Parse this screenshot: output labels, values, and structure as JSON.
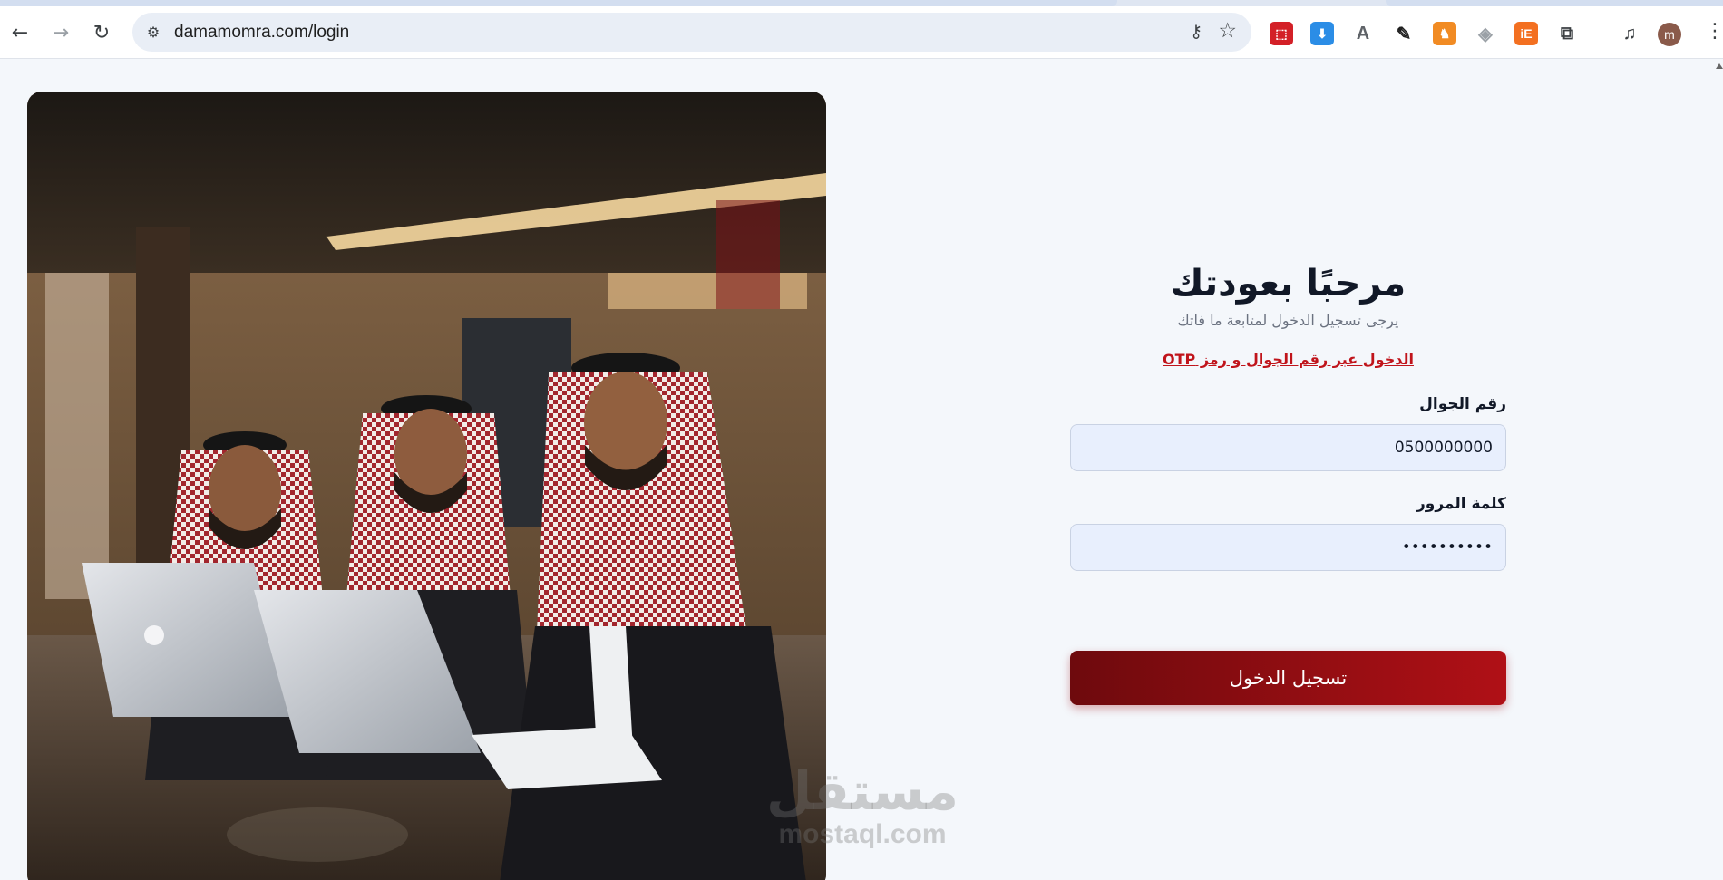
{
  "browser": {
    "url": "damamomra.com/login",
    "back_icon": "←",
    "forward_icon": "→",
    "reload_icon": "↻",
    "site_info_icon": "⚙",
    "key_icon": "⚷",
    "star_icon": "☆",
    "profile_initial": "m",
    "menu_icon": "⋮",
    "extensions": [
      {
        "name": "pdf-extension-icon",
        "glyph": "⬚",
        "color": "#d32027"
      },
      {
        "name": "download-extension-icon",
        "glyph": "⬇",
        "color": "#2b8de6"
      },
      {
        "name": "document-extension-icon",
        "glyph": "A",
        "color": "#5f6368"
      },
      {
        "name": "color-picker-extension-icon",
        "glyph": "✎",
        "color": "#1f1f1f"
      },
      {
        "name": "puzzle-character-extension-icon",
        "glyph": "♞",
        "color": "#f18b23"
      },
      {
        "name": "shield-extension-icon",
        "glyph": "◈",
        "color": "#9aa0a6"
      },
      {
        "name": "ie-extension-icon",
        "glyph": "iE",
        "color": "#f37021"
      },
      {
        "name": "extensions-puzzle-icon",
        "glyph": "⧉",
        "color": "#3c4043"
      },
      {
        "name": "media-controls-icon",
        "glyph": "♫",
        "color": "#3c4043"
      }
    ]
  },
  "login": {
    "title": "مرحبًا بعودتك",
    "subtitle": "يرجى تسجيل الدخول لمتابعة ما فاتك",
    "otp_link": "الدخول عبر رقم الجوال و رمز OTP",
    "phone_label": "رقم الجوال",
    "phone_value": "0500000000",
    "password_label": "كلمة المرور",
    "password_value": "••••••••••",
    "submit_label": "تسجيل الدخول"
  },
  "watermark": {
    "arabic": "مستقل",
    "latin": "mostaql.com"
  },
  "colors": {
    "accent": "#b01016",
    "accent_dark": "#6e0a0d",
    "link": "#c0141b",
    "input_bg": "#e8effd",
    "page_bg": "#f4f7fb"
  }
}
